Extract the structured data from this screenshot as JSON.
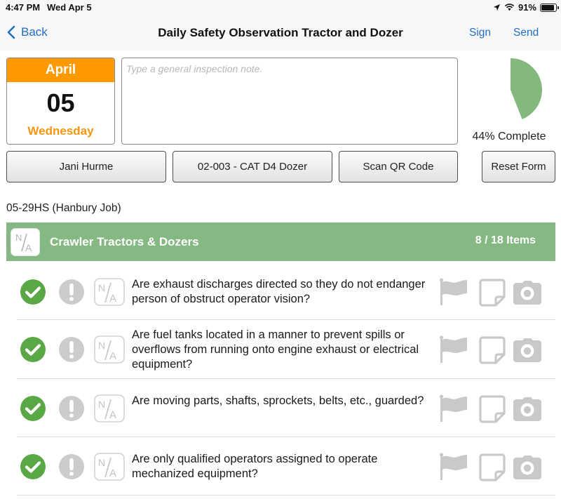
{
  "status_bar": {
    "time": "4:47 PM",
    "date": "Wed Apr 5",
    "battery_percent": "91%",
    "battery_level": 0.91,
    "icons": [
      "location-arrow-icon",
      "wifi-icon",
      "battery-icon"
    ]
  },
  "nav": {
    "back_label": "Back",
    "title": "Daily Safety Observation Tractor and Dozer",
    "sign_label": "Sign",
    "send_label": "Send"
  },
  "date_card": {
    "month": "April",
    "day": "05",
    "weekday": "Wednesday"
  },
  "note": {
    "value": "",
    "placeholder": "Type a general inspection note."
  },
  "progress": {
    "percent": 44,
    "label": "44% Complete"
  },
  "buttons": {
    "inspector": "Jani Hurme",
    "equipment": "02-003 - CAT D4 Dozer",
    "scan_qr": "Scan QR Code",
    "reset": "Reset Form"
  },
  "job": {
    "label": "05-29HS (Hanbury Job)"
  },
  "section": {
    "title": "Crawler Tractors & Dozers",
    "count": "8 / 18 Items",
    "na_label": "N/A"
  },
  "items": [
    {
      "question": "Are exhaust discharges directed so they do not endanger person of obstruct operator vision?",
      "status": "ok"
    },
    {
      "question": "Are fuel tanks located in a manner to prevent spills or overflows from running onto engine exhaust or electrical equipment?",
      "status": "ok"
    },
    {
      "question": "Are moving parts, shafts, sprockets, belts, etc., guarded?",
      "status": "ok"
    },
    {
      "question": "Are only qualified operators assigned to operate mechanized equipment?",
      "status": "ok"
    }
  ],
  "colors": {
    "accent_blue": "#1f6fc5",
    "orange": "#ff9900",
    "section_green": "#85b882",
    "check_green": "#5aa845",
    "pie_green": "#84b97e",
    "icon_gray": "#c9c9c9"
  }
}
